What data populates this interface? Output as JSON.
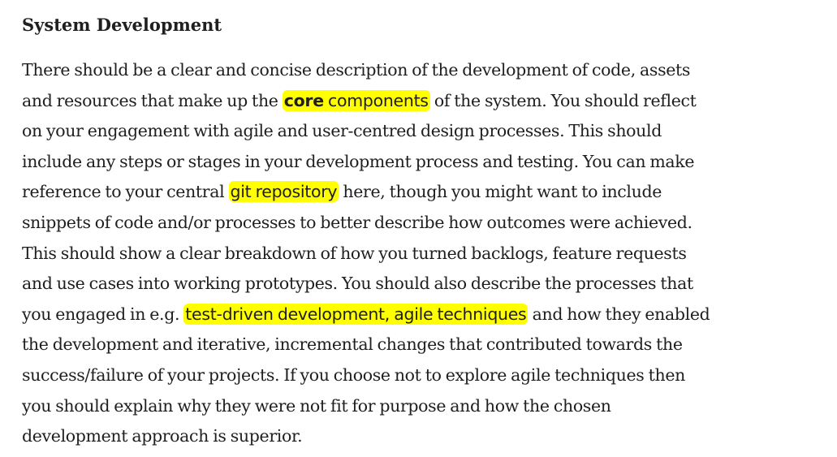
{
  "document": {
    "heading": "System Development",
    "lines": [
      {
        "before": "There should be a clear and concise description of the development of code, assets"
      },
      {
        "before": "and resources that make up the ",
        "hl_bold": "core",
        "hl_rest": " components",
        "after": " of the system. You should reflect"
      },
      {
        "before": "on your engagement with agile and user-centred design processes. This should"
      },
      {
        "before": "include any steps or stages in your development process and testing. You can make"
      },
      {
        "before": "reference to your central ",
        "hl_rest": "git repository",
        "after": " here, though you might want to include"
      },
      {
        "before": "snippets of code and/or processes to better describe how outcomes were achieved."
      },
      {
        "before": "This should show a clear breakdown of how you turned backlogs, feature requests"
      },
      {
        "before": "and use cases into working prototypes. You should also describe the processes that"
      },
      {
        "before": "you engaged in e.g. ",
        "hl_rest": "test-driven development, agile techniques",
        "after": " and how they enabled"
      },
      {
        "before": "the development and iterative, incremental changes that contributed towards the"
      },
      {
        "before": "success/failure of your projects. If you choose not to explore agile techniques then"
      },
      {
        "before": "you should explain why they were not fit for purpose and how the chosen"
      },
      {
        "before": "development approach is superior."
      }
    ]
  },
  "colors": {
    "highlight": "#ffff00",
    "text": "#1f1f1f",
    "background": "#ffffff"
  }
}
